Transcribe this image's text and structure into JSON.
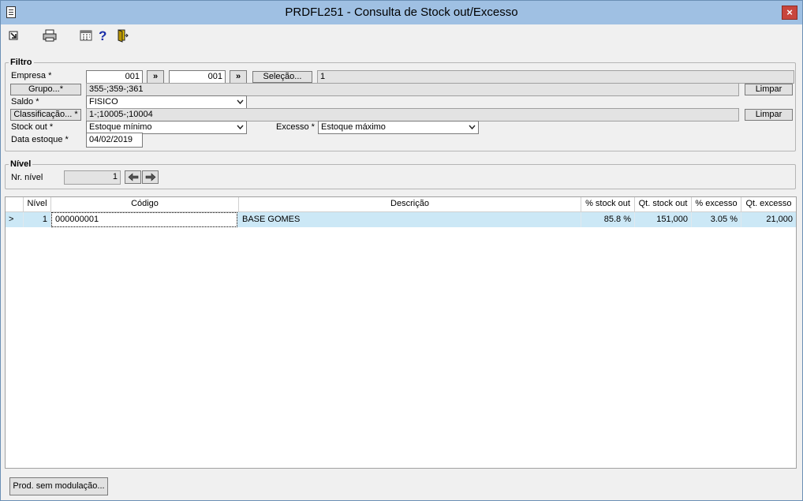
{
  "window": {
    "title": "PRDFL251 - Consulta de Stock out/Excesso",
    "close_label": "×"
  },
  "toolbar": {
    "icons": [
      "exit-icon",
      "print-icon",
      "calculator-icon",
      "help-icon",
      "door-icon"
    ]
  },
  "filtro": {
    "title": "Filtro",
    "empresa_label": "Empresa *",
    "empresa_from": "001",
    "empresa_to": "001",
    "empresa_nav1": "»",
    "empresa_nav2": "»",
    "selecao_label": "Seleção...",
    "selecao_value": "1",
    "grupo_label": "Grupo...*",
    "grupo_value": "355-;359-;361",
    "grupo_limpar": "Limpar",
    "saldo_label": "Saldo *",
    "saldo_value": "FISICO",
    "classificacao_label": "Classificação... *",
    "classificacao_value": "1-;10005-;10004",
    "classificacao_limpar": "Limpar",
    "stockout_label": "Stock out *",
    "stockout_value": "Estoque mínimo",
    "excesso_label": "Excesso *",
    "excesso_value": "Estoque máximo",
    "data_label": "Data estoque *",
    "data_value": "04/02/2019"
  },
  "nivel": {
    "title": "Nível",
    "nr_label": "Nr. nível",
    "nr_value": "1"
  },
  "grid": {
    "columns": [
      "",
      "Nível",
      "Código",
      "Descrição",
      "% stock out",
      "Qt. stock out",
      "% excesso",
      "Qt. excesso"
    ],
    "rows": [
      {
        "marker": ">",
        "nivel": "1",
        "codigo": "000000001",
        "descricao": "BASE GOMES",
        "pct_stockout": "85.8 %",
        "qt_stockout": "151,000",
        "pct_excesso": "3.05 %",
        "qt_excesso": "21,000"
      }
    ]
  },
  "footer": {
    "prod_button": "Prod. sem modulação..."
  },
  "colors": {
    "titlebar": "#9fc0e3",
    "selected_row": "#cce8f6",
    "close_button": "#c8463d"
  }
}
